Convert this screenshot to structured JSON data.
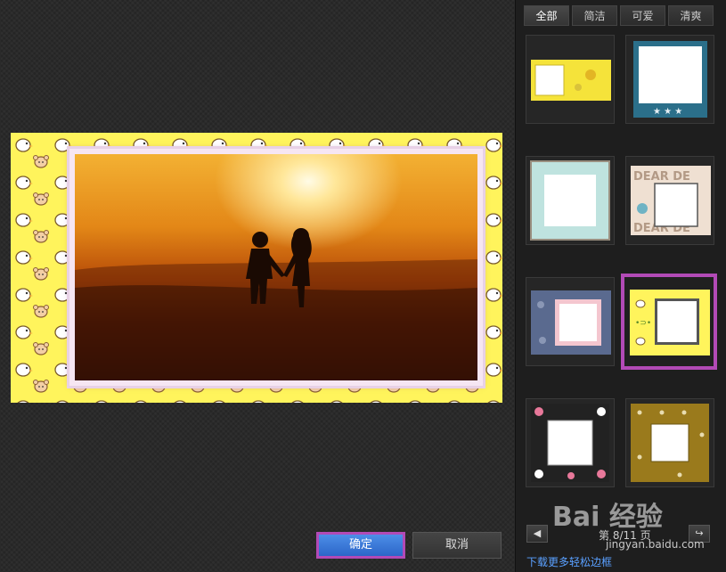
{
  "tabs": [
    {
      "label": "全部",
      "active": true
    },
    {
      "label": "简洁",
      "active": false
    },
    {
      "label": "可爱",
      "active": false
    },
    {
      "label": "清爽",
      "active": false
    }
  ],
  "buttons": {
    "confirm_label": "确定",
    "cancel_label": "取消"
  },
  "pager": {
    "text": "第 8/11 页",
    "prev_icon": "arrow-left-icon",
    "next_icon": "arrow-right-icon"
  },
  "link": {
    "more_frames": "下载更多轻松边框"
  },
  "watermark": {
    "logo": "Bai 经验",
    "url": "jingyan.baidu.com"
  },
  "colors": {
    "accent_highlight": "#b24ab6",
    "confirm_blue": "#2c66c8",
    "link_blue": "#5aa0ff",
    "frame_yellow": "#fff45c"
  },
  "thumbnails": [
    {
      "name": "frame-yellow-strip",
      "selected": false
    },
    {
      "name": "frame-teal-stars",
      "selected": false
    },
    {
      "name": "frame-mint",
      "selected": false
    },
    {
      "name": "frame-dear-bears",
      "selected": false
    },
    {
      "name": "frame-denim-bears",
      "selected": false
    },
    {
      "name": "frame-yellow-chicks",
      "selected": true
    },
    {
      "name": "frame-pink-dots",
      "selected": false
    },
    {
      "name": "frame-olive-dots",
      "selected": false
    }
  ]
}
